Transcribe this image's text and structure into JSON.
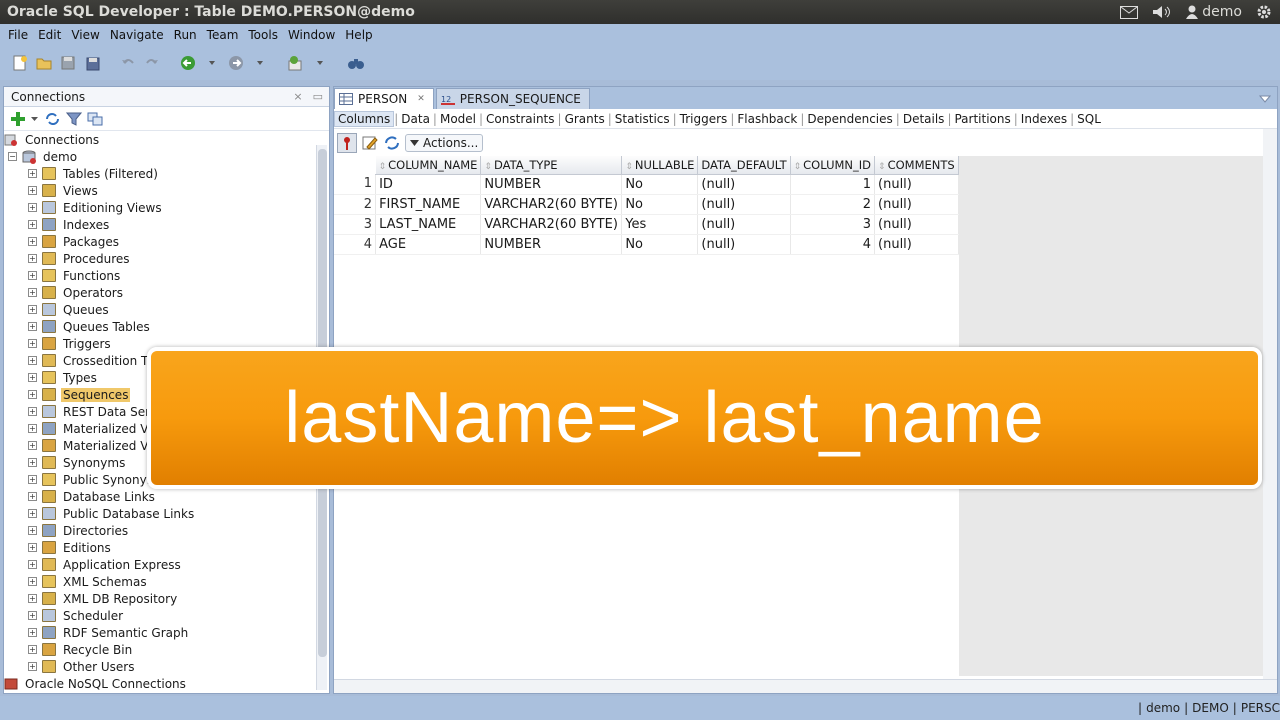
{
  "window": {
    "title": "Oracle SQL Developer : Table DEMO.PERSON@demo",
    "user": "demo"
  },
  "menu": [
    "File",
    "Edit",
    "View",
    "Navigate",
    "Run",
    "Team",
    "Tools",
    "Window",
    "Help"
  ],
  "connections_panel": {
    "title": "Connections",
    "root": "Connections",
    "connection": "demo",
    "items": [
      {
        "label": "Tables (Filtered)",
        "icon": "tables-icon"
      },
      {
        "label": "Views",
        "icon": "views-icon"
      },
      {
        "label": "Editioning Views",
        "icon": "editioning-views-icon"
      },
      {
        "label": "Indexes",
        "icon": "indexes-icon"
      },
      {
        "label": "Packages",
        "icon": "packages-icon"
      },
      {
        "label": "Procedures",
        "icon": "procedures-icon"
      },
      {
        "label": "Functions",
        "icon": "functions-icon"
      },
      {
        "label": "Operators",
        "icon": "operators-icon"
      },
      {
        "label": "Queues",
        "icon": "queues-icon"
      },
      {
        "label": "Queues Tables",
        "icon": "queues-tables-icon"
      },
      {
        "label": "Triggers",
        "icon": "triggers-icon"
      },
      {
        "label": "Crossedition T",
        "icon": "crossedition-icon"
      },
      {
        "label": "Types",
        "icon": "types-icon"
      },
      {
        "label": "Sequences",
        "icon": "sequences-icon"
      },
      {
        "label": "REST Data Ser",
        "icon": "rest-data-icon"
      },
      {
        "label": "Materialized Vi",
        "icon": "mview-icon"
      },
      {
        "label": "Materialized Vi",
        "icon": "mview-log-icon"
      },
      {
        "label": "Synonyms",
        "icon": "synonyms-icon"
      },
      {
        "label": "Public Synonyn",
        "icon": "public-synonyms-icon"
      },
      {
        "label": "Database Links",
        "icon": "db-links-icon"
      },
      {
        "label": "Public Database Links",
        "icon": "public-db-links-icon"
      },
      {
        "label": "Directories",
        "icon": "directories-icon"
      },
      {
        "label": "Editions",
        "icon": "editions-icon"
      },
      {
        "label": "Application Express",
        "icon": "apex-icon"
      },
      {
        "label": "XML Schemas",
        "icon": "xml-schemas-icon"
      },
      {
        "label": "XML DB Repository",
        "icon": "xml-db-icon"
      },
      {
        "label": "Scheduler",
        "icon": "scheduler-icon"
      },
      {
        "label": "RDF Semantic Graph",
        "icon": "rdf-icon"
      },
      {
        "label": "Recycle Bin",
        "icon": "recycle-bin-icon"
      },
      {
        "label": "Other Users",
        "icon": "other-users-icon"
      }
    ],
    "nosql": "Oracle NoSQL Connections"
  },
  "editor_tabs": [
    "PERSON",
    "PERSON_SEQUENCE"
  ],
  "sub_tabs": [
    "Columns",
    "Data",
    "Model",
    "Constraints",
    "Grants",
    "Statistics",
    "Triggers",
    "Flashback",
    "Dependencies",
    "Details",
    "Partitions",
    "Indexes",
    "SQL"
  ],
  "actions_label": "Actions...",
  "grid": {
    "headers": [
      "COLUMN_NAME",
      "DATA_TYPE",
      "NULLABLE",
      "DATA_DEFAULT",
      "COLUMN_ID",
      "COMMENTS"
    ],
    "rows": [
      {
        "n": "1",
        "c": [
          "ID",
          "NUMBER",
          "No",
          "(null)",
          "1",
          "(null)"
        ]
      },
      {
        "n": "2",
        "c": [
          "FIRST_NAME",
          "VARCHAR2(60 BYTE)",
          "No",
          "(null)",
          "2",
          "(null)"
        ]
      },
      {
        "n": "3",
        "c": [
          "LAST_NAME",
          "VARCHAR2(60 BYTE)",
          "Yes",
          "(null)",
          "3",
          "(null)"
        ]
      },
      {
        "n": "4",
        "c": [
          "AGE",
          "NUMBER",
          "No",
          "(null)",
          "4",
          "(null)"
        ]
      }
    ]
  },
  "status": {
    "a": "demo",
    "b": "DEMO",
    "c": "PERSC"
  },
  "banner": "lastName=> last_name"
}
